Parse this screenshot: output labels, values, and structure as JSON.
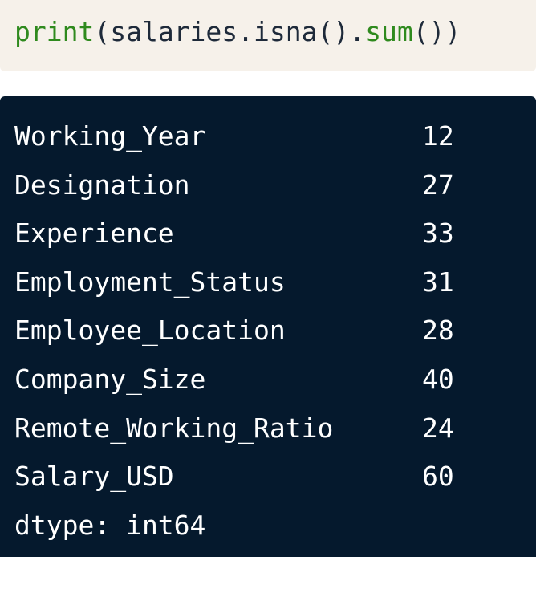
{
  "code": {
    "tokens": [
      {
        "text": "print",
        "kind": "fn"
      },
      {
        "text": "(salaries.isna().",
        "kind": "plain"
      },
      {
        "text": "sum",
        "kind": "fn"
      },
      {
        "text": "())",
        "kind": "plain"
      }
    ]
  },
  "output": {
    "rows": [
      {
        "name": "Working_Year",
        "count": "12"
      },
      {
        "name": "Designation",
        "count": "27"
      },
      {
        "name": "Experience",
        "count": "33"
      },
      {
        "name": "Employment_Status",
        "count": "31"
      },
      {
        "name": "Employee_Location",
        "count": "28"
      },
      {
        "name": "Company_Size",
        "count": "40"
      },
      {
        "name": "Remote_Working_Ratio",
        "count": "24"
      },
      {
        "name": "Salary_USD",
        "count": "60"
      }
    ],
    "dtype": "dtype: int64"
  },
  "colors": {
    "code_bg": "#f6f1ea",
    "function_green": "#2f8a1e",
    "code_text": "#1e2a3a",
    "output_bg": "#05192d",
    "output_text": "#ffffff"
  }
}
